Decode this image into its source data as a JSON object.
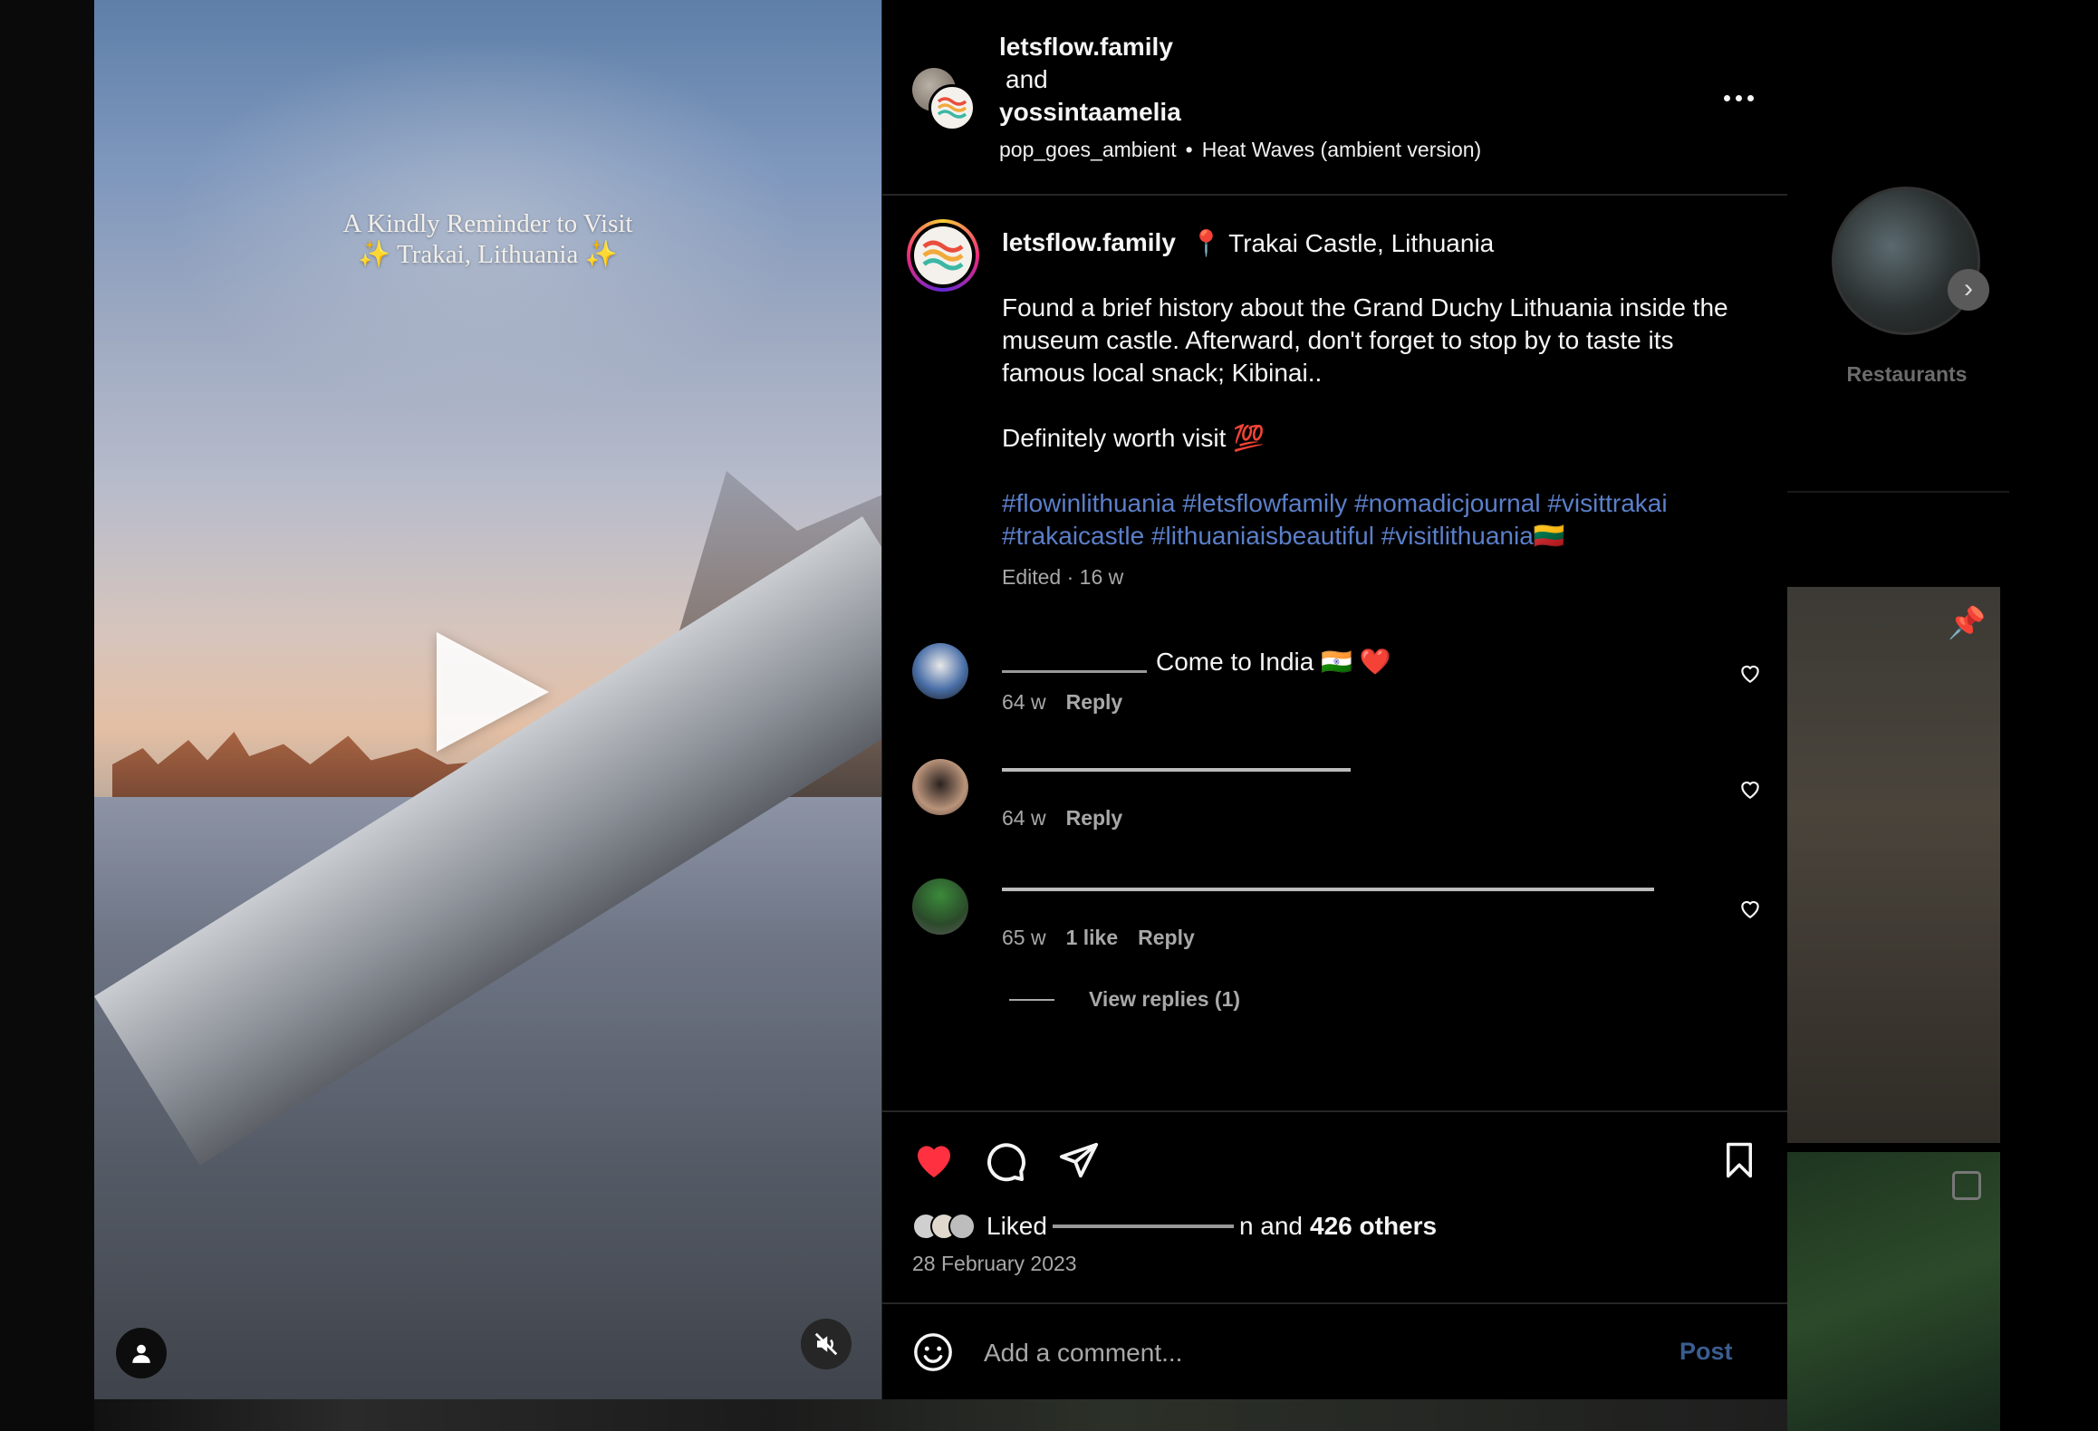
{
  "video": {
    "caption_line1": "A Kindly Reminder to Visit",
    "caption_line2": "✨ Trakai, Lithuania ✨"
  },
  "header": {
    "author1": "letsflow.family",
    "conjunction": "and",
    "author2": "yossintaamelia",
    "audio_artist": "pop_goes_ambient",
    "audio_separator": "•",
    "audio_track": "Heat Waves (ambient version)"
  },
  "caption": {
    "username": "letsflow.family",
    "location": "📍 Trakai Castle, Lithuania",
    "paragraph1": "Found a brief history about the Grand Duchy Lithuania inside the museum castle. Afterward, don't forget to stop by to taste its famous local snack; Kibinai..",
    "paragraph2": "Definitely worth visit 💯",
    "hashtags": "#flowinlithuania #letsflowfamily #nomadicjournal #visittrakai #trakaicastle #lithuaniaisbeautiful #visitlithuania🇱🇹",
    "edited": "Edited · 16 w"
  },
  "comments": [
    {
      "text": "Come to India 🇮🇳 ❤️",
      "age": "64 w",
      "likes": "",
      "reply": "Reply"
    },
    {
      "text": "",
      "age": "64 w",
      "likes": "",
      "reply": "Reply"
    },
    {
      "text": "",
      "age": "65 w",
      "likes": "1 like",
      "reply": "Reply"
    }
  ],
  "view_replies": "View replies (1)",
  "likes": {
    "prefix": "Liked",
    "middle": "n and",
    "others": "426 others"
  },
  "post_date": "28 February 2023",
  "composer": {
    "placeholder": "Add a comment...",
    "post_label": "Post"
  },
  "sidebar": {
    "story_label": "Restaurants"
  },
  "colors": {
    "like_red": "#ff3040",
    "hashtag_blue": "#5b7fc9",
    "muted": "#a8a8a8"
  }
}
